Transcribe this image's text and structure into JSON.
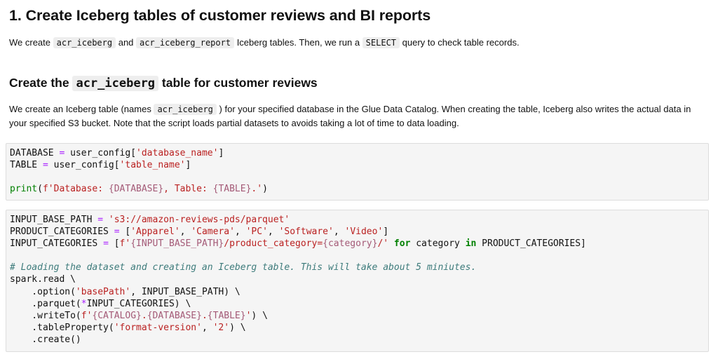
{
  "heading1": "1. Create Iceberg tables of customer reviews and BI reports",
  "intro": {
    "t1": "We create ",
    "c1": "acr_iceberg",
    "t2": " and ",
    "c2": "acr_iceberg_report",
    "t3": " Iceberg tables. Then, we run a ",
    "c3": "SELECT",
    "t4": " query to check table records."
  },
  "heading2": {
    "t1": "Create the ",
    "c1": "acr_iceberg",
    "t2": " table for customer reviews"
  },
  "para2": {
    "t1": "We create an Iceberg table (names ",
    "c1": "acr_iceberg",
    "t2": " ) for your specified database in the Glue Data Catalog. When creating the table, Iceberg also writes the actual data in your specified S3 bucket. Note that the script loads partial datasets to avoids taking a lot of time to data loading."
  },
  "cell1": {
    "l1a": "DATABASE ",
    "l1op": "=",
    "l1b": " user_config[",
    "l1s": "'database_name'",
    "l1c": "]",
    "l2a": "TABLE ",
    "l2op": "=",
    "l2b": " user_config[",
    "l2s": "'table_name'",
    "l2c": "]",
    "l4fn": "print",
    "l4a": "(",
    "l4s1": "f'Database: ",
    "l4i1": "{DATABASE}",
    "l4s2": ", Table: ",
    "l4i2": "{TABLE}",
    "l4s3": ".'",
    "l4b": ")"
  },
  "cell2": {
    "l1a": "INPUT_BASE_PATH ",
    "l1op": "=",
    "l1s": " 's3://amazon-reviews-pds/parquet'",
    "l2a": "PRODUCT_CATEGORIES ",
    "l2op": "=",
    "l2b": " [",
    "l2s1": "'Apparel'",
    "l2s2": "'Camera'",
    "l2s3": "'PC'",
    "l2s4": "'Software'",
    "l2s5": "'Video'",
    "l2c": "]",
    "l3a": "INPUT_CATEGORIES ",
    "l3op": "=",
    "l3b": " [",
    "l3s1": "f'",
    "l3i1": "{INPUT_BASE_PATH}",
    "l3s2": "/product_category=",
    "l3i2": "{category}",
    "l3s3": "/'",
    "l3kw1": "for",
    "l3c": " category ",
    "l3kw2": "in",
    "l3d": " PRODUCT_CATEGORIES]",
    "l5cm": "# Loading the dataset and creating an Iceberg table. This will take about 5 miniutes.",
    "l6": "spark.read \\",
    "l7a": "    .option(",
    "l7s": "'basePath'",
    "l7b": ", INPUT_BASE_PATH) \\",
    "l8a": "    .parquet(",
    "l8op": "*",
    "l8b": "INPUT_CATEGORIES) \\",
    "l9a": "    .writeTo(",
    "l9s1": "f'",
    "l9i1": "{CATALOG}",
    "l9s2": ".",
    "l9i2": "{DATABASE}",
    "l9s3": ".",
    "l9i3": "{TABLE}",
    "l9s4": "'",
    "l9b": ") \\",
    "l10a": "    .tableProperty(",
    "l10s1": "'format-version'",
    "l10b": ", ",
    "l10s2": "'2'",
    "l10c": ") \\",
    "l11": "    .create()"
  }
}
